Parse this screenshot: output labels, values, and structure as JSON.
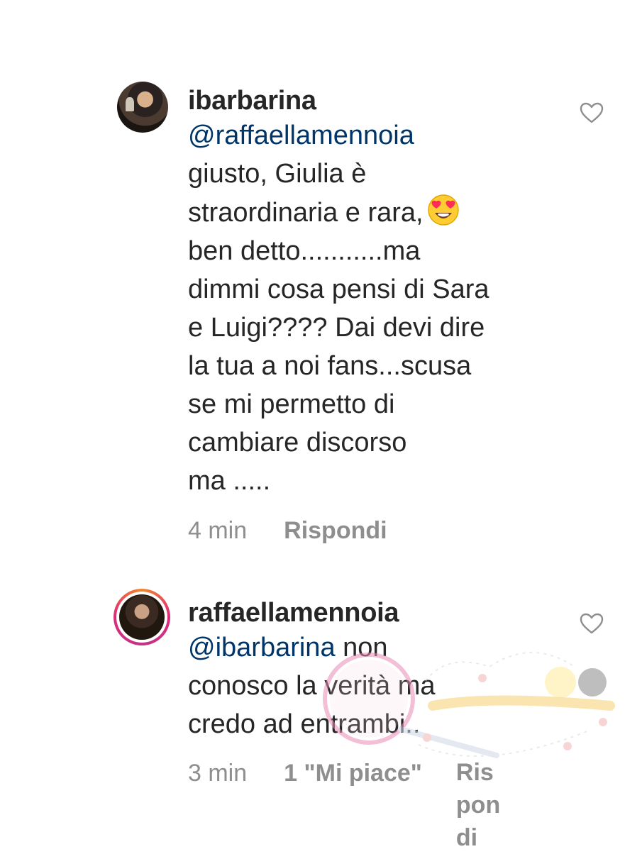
{
  "comments": [
    {
      "username": "ibarbarina",
      "mention": "@raffaellamennoia",
      "text_lines": [
        "giusto, Giulia è",
        "straordinaria e rara,",
        "ben detto...........ma",
        "dimmi cosa pensi di Sara",
        "e Luigi???? Dai devi dire",
        "la tua a noi fans...scusa",
        "se mi permetto di",
        "cambiare discorso",
        "ma ....."
      ],
      "emoji": "heart-eyes-emoji",
      "time": "4 min",
      "reply": "Rispondi",
      "has_story_ring": false
    },
    {
      "username": "raffaellamennoia",
      "mention": "@ibarbarina",
      "text_after_mention": " non",
      "text_lines": [
        "conosco la verità ma",
        "credo ad entrambi.."
      ],
      "time": "3 min",
      "likes": "1 \"Mi piace\"",
      "reply_lines": [
        "Ris",
        "pon",
        "di"
      ],
      "has_story_ring": true
    }
  ],
  "icons": {
    "like": "heart-outline-icon"
  },
  "colors": {
    "mention": "#003569",
    "meta": "#8e8e8e",
    "text": "#262626"
  }
}
